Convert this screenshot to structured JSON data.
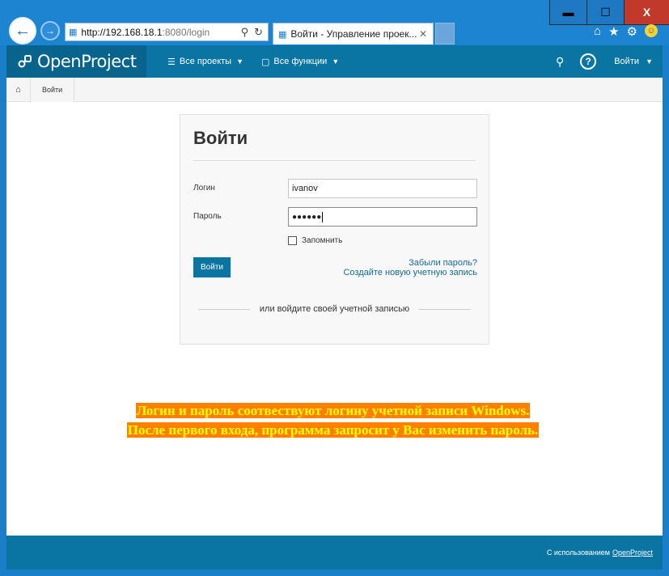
{
  "browser": {
    "window_buttons": {
      "minimize": "▬",
      "maximize": "☐",
      "close": "X"
    },
    "address": {
      "host": "http://192.168.18.1",
      "rest": ":8080/login"
    },
    "tab": {
      "title": "Войти - Управление проек...",
      "close": "✕"
    },
    "icons": [
      "back-arrow-icon",
      "forward-arrow-icon",
      "page-icon",
      "search-icon",
      "refresh-icon",
      "home-icon",
      "star-icon",
      "gear-icon",
      "smiley-icon"
    ]
  },
  "app": {
    "logo": "OpenProject",
    "menu": [
      {
        "label": "Все проекты",
        "icon": "layers-icon"
      },
      {
        "label": "Все функции",
        "icon": "cube-icon"
      }
    ],
    "user_menu": "Войти"
  },
  "breadcrumb": {
    "item": "Войти"
  },
  "login": {
    "title": "Войти",
    "login_label": "Логин",
    "login_value": "ivanov",
    "password_label": "Пароль",
    "password_value": "●●●●●●",
    "remember_label": "Запомнить",
    "button_label": "Войти",
    "forgot_link": "Забыли пароль?",
    "register_link": "Создайте новую учетную запись",
    "alt_login_text": "или войдите своей учетной записью"
  },
  "notice": {
    "line1": "Логин и пароль соотвествуют логину учетной записи Windows.",
    "line2": "После первого входа, программа запросит у Вас изменить пароль."
  },
  "footer": {
    "prefix": "С использованием",
    "link": "OpenProject"
  },
  "colors": {
    "topbar": "#0a74a3",
    "logo_bg": "#08648c",
    "notice_bg": "#ff7f00",
    "notice_text": "#ffff00"
  }
}
